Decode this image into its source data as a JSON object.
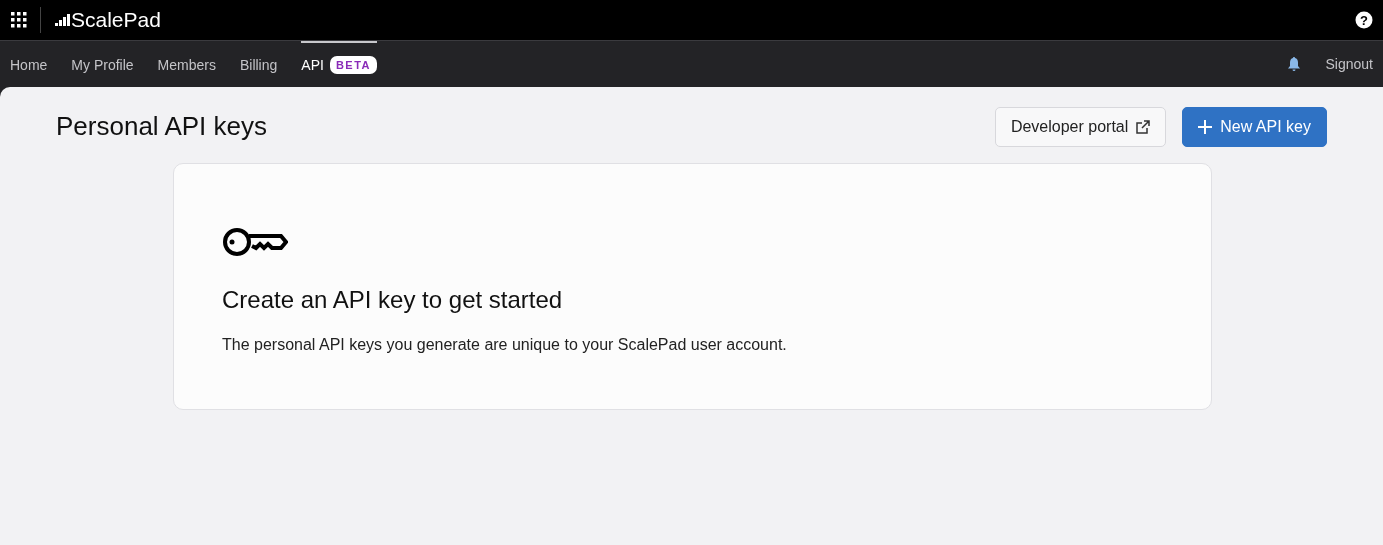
{
  "topbar": {
    "logo": "ScalePad",
    "help": "?"
  },
  "nav": {
    "tabs": [
      {
        "label": "Home",
        "selected": false
      },
      {
        "label": "My Profile",
        "selected": false
      },
      {
        "label": "Members",
        "selected": false
      },
      {
        "label": "Billing",
        "selected": false
      },
      {
        "label": "API",
        "badge": "BETA",
        "selected": true
      }
    ],
    "signout": "Signout"
  },
  "page": {
    "title": "Personal API keys",
    "buttons": [
      {
        "label": "Developer portal",
        "kind": "secondary"
      },
      {
        "label": "New API key",
        "kind": "primary"
      }
    ]
  },
  "empty_state": {
    "heading": "Create an API key to get started",
    "text": "The personal API keys you generate are unique to your ScalePad user account."
  }
}
